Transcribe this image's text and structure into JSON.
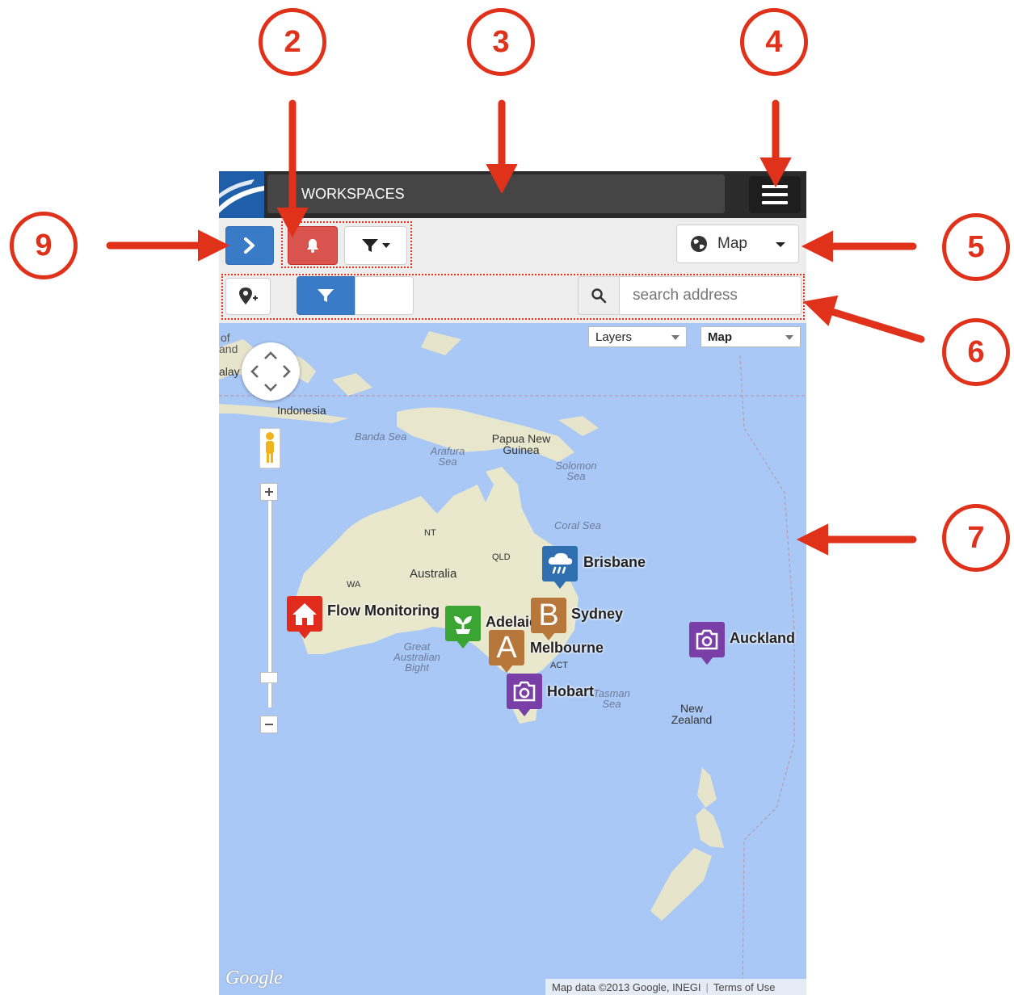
{
  "callouts": {
    "c2": "2",
    "c3": "3",
    "c4": "4",
    "c5": "5",
    "c6": "6",
    "c7": "7",
    "c9": "9"
  },
  "header": {
    "title": "WORKSPACES"
  },
  "toolbar": {
    "view_select_label": "Map"
  },
  "search": {
    "placeholder": "search address"
  },
  "map_controls": {
    "layers_label": "Layers",
    "maptype_label": "Map"
  },
  "map_labels": {
    "indonesia": "Indonesia",
    "png": "Papua New Guinea",
    "australia": "Australia",
    "nt": "NT",
    "qld": "QLD",
    "wa": "WA",
    "act": "ACT",
    "nz": "New Zealand",
    "banda_sea": "Banda Sea",
    "arafura_sea": "Arafura Sea",
    "solomon_sea": "Solomon Sea",
    "coral_sea": "Coral Sea",
    "great_australian_bight": "Great Australian Bight",
    "tasman_sea": "Tasman Sea",
    "edge_of": "of",
    "edge_and": "and",
    "edge_malay": "alay"
  },
  "markers": [
    {
      "label": "Brisbane",
      "icon": "rain-cloud-icon",
      "color": "#2f6fb0"
    },
    {
      "label": "Flow Monitoring",
      "icon": "house-icon",
      "color": "#e12b1c"
    },
    {
      "label": "Adelaide",
      "icon": "plant-icon",
      "color": "#3aa532"
    },
    {
      "label": "Sydney",
      "icon": "letter-b-icon",
      "color": "#b8773a"
    },
    {
      "label": "Melbourne",
      "icon": "letter-a-icon",
      "color": "#b8773a"
    },
    {
      "label": "Hobart",
      "icon": "camera-icon",
      "color": "#7a3fa6"
    },
    {
      "label": "Auckland",
      "icon": "camera-icon",
      "color": "#7a3fa6"
    }
  ],
  "marker_letters": {
    "sydney": "B",
    "melbourne": "A"
  },
  "footer": {
    "google": "Google",
    "map_data": "Map data ©2013 Google, INEGI",
    "terms": "Terms of Use"
  },
  "colors": {
    "callout": "#e0311b",
    "primary_button": "#3a7bc8",
    "alert_button": "#d9534f",
    "water": "#a9c8f6",
    "land": "#eae6cf"
  }
}
